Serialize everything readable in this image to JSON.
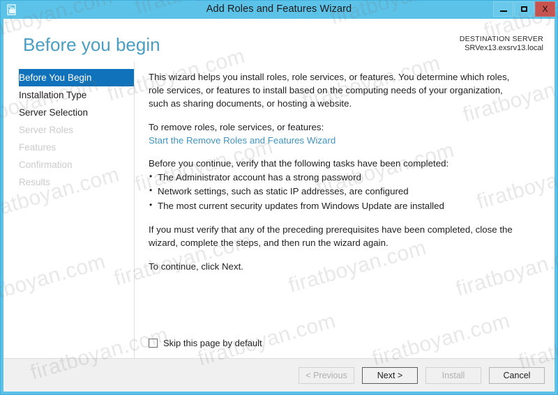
{
  "window": {
    "title": "Add Roles and Features Wizard",
    "icon": "server-manager-icon",
    "controls": {
      "minimize": "minimize-icon",
      "maximize": "maximize-icon",
      "close": "X"
    },
    "accent_color": "#5cc2e8",
    "close_color": "#c9514e"
  },
  "header": {
    "page_title": "Before you begin",
    "page_title_color": "#4a9ec4",
    "destination_label": "DESTINATION SERVER",
    "destination_value": "SRVex13.exsrv13.local"
  },
  "nav": {
    "selected_color": "#0f72ba",
    "items": [
      {
        "label": "Before You Begin",
        "state": "selected"
      },
      {
        "label": "Installation Type",
        "state": "enabled"
      },
      {
        "label": "Server Selection",
        "state": "enabled"
      },
      {
        "label": "Server Roles",
        "state": "disabled"
      },
      {
        "label": "Features",
        "state": "disabled"
      },
      {
        "label": "Confirmation",
        "state": "disabled"
      },
      {
        "label": "Results",
        "state": "disabled"
      }
    ]
  },
  "content": {
    "intro_paragraph": "This wizard helps you install roles, role services, or features. You determine which roles, role services, or features to install based on the computing needs of your organization, such as sharing documents, or hosting a website.",
    "remove_lead": "To remove roles, role services, or features:",
    "remove_link": "Start the Remove Roles and Features Wizard",
    "remove_link_color": "#3f94c4",
    "verify_lead": "Before you continue, verify that the following tasks have been completed:",
    "bullets": [
      "The Administrator account has a strong password",
      "Network settings, such as static IP addresses, are configured",
      "The most current security updates from Windows Update are installed"
    ],
    "verify_paragraph": "If you must verify that any of the preceding prerequisites have been completed, close the wizard, complete the steps, and then run the wizard again.",
    "continue_paragraph": "To continue, click Next.",
    "skip_checkbox_label": "Skip this page by default",
    "skip_checkbox_checked": false
  },
  "footer": {
    "buttons": [
      {
        "label": "< Previous",
        "state": "disabled"
      },
      {
        "label": "Next >",
        "state": "default"
      },
      {
        "label": "Install",
        "state": "disabled"
      },
      {
        "label": "Cancel",
        "state": "enabled"
      }
    ]
  },
  "watermark": {
    "text": "firatboyan.com"
  }
}
